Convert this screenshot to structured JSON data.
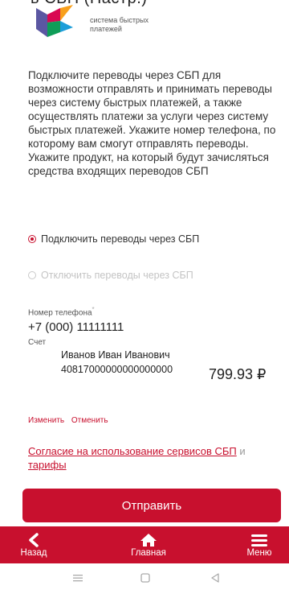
{
  "header": {
    "title": "в СБП (Настр.)",
    "logo_text": "система быстрых платежей"
  },
  "description": "Подключите переводы через СБП для возможности отправлять и принимать переводы через систему быстрых платежей, а также осуществлять платежи за услуги через систему быстрых платежей. Укажите номер телефона, по которому вам смогут отправлять переводы. Укажите продукт, на который будут зачисляться средства входящих переводов СБП",
  "options": [
    {
      "label": "Подключить переводы через СБП",
      "selected": true
    },
    {
      "label": "Отключить переводы через СБП",
      "selected": false
    }
  ],
  "phone": {
    "label": "Номер телефона",
    "required_mark": "*",
    "value": "+7 (000) 11111111"
  },
  "account": {
    "label": "Счет",
    "name": "Иванов Иван Иванович",
    "number": "40817000000000000000",
    "balance": "799.93 ₽"
  },
  "actions": {
    "change": "Изменить",
    "cancel": "Отменить"
  },
  "agreement": {
    "link1": "Согласие на использование сервисов СБП",
    "connector": " и ",
    "link2": "тарифы"
  },
  "submit_label": "Отправить",
  "bottom_nav": {
    "back": "Назад",
    "home": "Главная",
    "menu": "Меню"
  },
  "colors": {
    "accent": "#c8102e",
    "muted": "#c4c4c4"
  },
  "icons": [
    "sbp-logo-icon",
    "chevron-left-icon",
    "home-icon",
    "hamburger-menu-icon",
    "recent-apps-icon",
    "home-square-icon",
    "back-triangle-icon"
  ]
}
